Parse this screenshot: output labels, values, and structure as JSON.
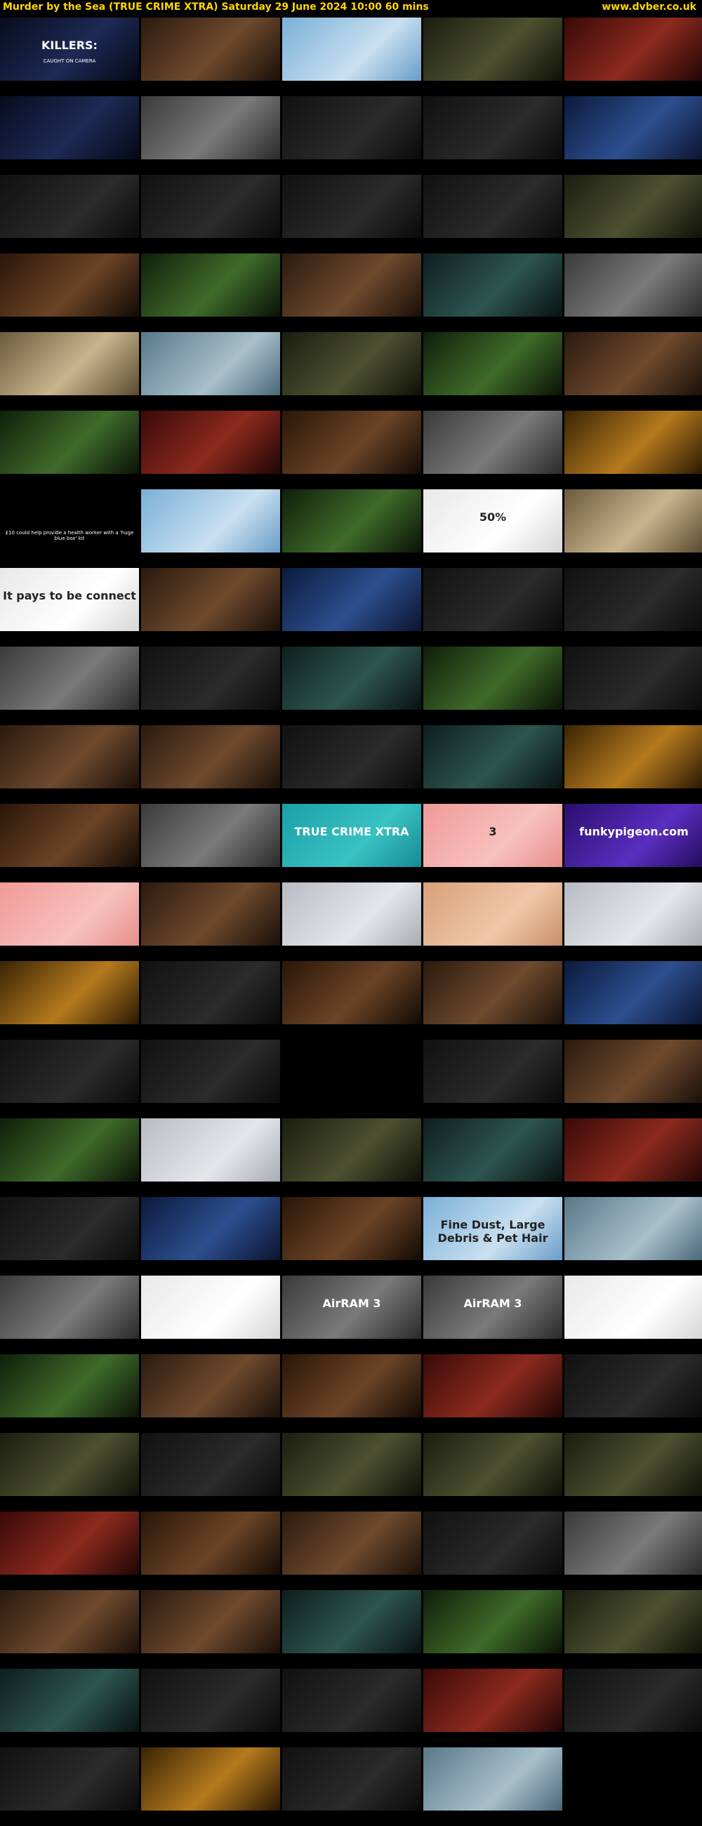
{
  "header": {
    "title": "Murder by the Sea (TRUE CRIME XTRA)    Saturday 29 June 2024  10:00  60 mins",
    "site": "www.dvber.co.uk"
  },
  "thumbnails": [
    [
      {
        "c": "navy",
        "big": "KILLERS:",
        "sm": "CAUGHT ON CAMERA"
      },
      {
        "c": "brown"
      },
      {
        "c": "sky"
      },
      {
        "c": "olive"
      },
      {
        "c": "red"
      }
    ],
    [
      {
        "c": "navy"
      },
      {
        "c": "grey"
      },
      {
        "c": "dark"
      },
      {
        "c": "dark"
      },
      {
        "c": "blue"
      }
    ],
    [
      {
        "c": "dark"
      },
      {
        "c": "dark"
      },
      {
        "c": "dark"
      },
      {
        "c": "dark"
      },
      {
        "c": "olive"
      }
    ],
    [
      {
        "c": "warm"
      },
      {
        "c": "green"
      },
      {
        "c": "brown"
      },
      {
        "c": "teal"
      },
      {
        "c": "grey"
      }
    ],
    [
      {
        "c": "sand"
      },
      {
        "c": "sea"
      },
      {
        "c": "olive"
      },
      {
        "c": "green"
      },
      {
        "c": "brown"
      }
    ],
    [
      {
        "c": "green"
      },
      {
        "c": "red"
      },
      {
        "c": "warm"
      },
      {
        "c": "grey"
      },
      {
        "c": "amber"
      }
    ],
    [
      {
        "c": "black",
        "sm": "£10 could help provide a health worker with a 'huge blue box' kit"
      },
      {
        "c": "sky"
      },
      {
        "c": "green"
      },
      {
        "c": "white",
        "big": "50%"
      },
      {
        "c": "sand"
      }
    ],
    [
      {
        "c": "white",
        "big": "It pays to be connect"
      },
      {
        "c": "brown"
      },
      {
        "c": "blue"
      },
      {
        "c": "dark"
      },
      {
        "c": "dark"
      }
    ],
    [
      {
        "c": "grey"
      },
      {
        "c": "dark"
      },
      {
        "c": "teal"
      },
      {
        "c": "green"
      },
      {
        "c": "dark"
      }
    ],
    [
      {
        "c": "brown"
      },
      {
        "c": "brown"
      },
      {
        "c": "dark"
      },
      {
        "c": "teal"
      },
      {
        "c": "amber"
      }
    ],
    [
      {
        "c": "warm"
      },
      {
        "c": "grey"
      },
      {
        "c": "cyan",
        "big": "TRUE CRIME XTRA"
      },
      {
        "c": "pink",
        "big": "3"
      },
      {
        "c": "purple",
        "big": "funkypigeon.com"
      }
    ],
    [
      {
        "c": "pink"
      },
      {
        "c": "brown"
      },
      {
        "c": "light"
      },
      {
        "c": "peach"
      },
      {
        "c": "light"
      }
    ],
    [
      {
        "c": "amber"
      },
      {
        "c": "dark"
      },
      {
        "c": "warm"
      },
      {
        "c": "brown"
      },
      {
        "c": "blue"
      }
    ],
    [
      {
        "c": "dark"
      },
      {
        "c": "dark"
      },
      {
        "c": "black"
      },
      {
        "c": "dark"
      },
      {
        "c": "brown"
      }
    ],
    [
      {
        "c": "green"
      },
      {
        "c": "light"
      },
      {
        "c": "olive"
      },
      {
        "c": "teal"
      },
      {
        "c": "red"
      }
    ],
    [
      {
        "c": "dark"
      },
      {
        "c": "blue"
      },
      {
        "c": "warm"
      },
      {
        "c": "sky",
        "big": "Fine Dust, Large Debris & Pet Hair"
      },
      {
        "c": "sea"
      }
    ],
    [
      {
        "c": "grey"
      },
      {
        "c": "white"
      },
      {
        "c": "grey",
        "big": "AirRAM 3"
      },
      {
        "c": "grey",
        "big": "AirRAM 3"
      },
      {
        "c": "white"
      }
    ],
    [
      {
        "c": "green"
      },
      {
        "c": "brown"
      },
      {
        "c": "warm"
      },
      {
        "c": "red"
      },
      {
        "c": "dark"
      }
    ],
    [
      {
        "c": "olive"
      },
      {
        "c": "dark"
      },
      {
        "c": "olive"
      },
      {
        "c": "olive"
      },
      {
        "c": "olive"
      }
    ],
    [
      {
        "c": "red"
      },
      {
        "c": "warm"
      },
      {
        "c": "brown"
      },
      {
        "c": "dark"
      },
      {
        "c": "grey"
      }
    ],
    [
      {
        "c": "brown"
      },
      {
        "c": "brown"
      },
      {
        "c": "teal"
      },
      {
        "c": "green"
      },
      {
        "c": "olive"
      }
    ],
    [
      {
        "c": "teal"
      },
      {
        "c": "dark"
      },
      {
        "c": "dark"
      },
      {
        "c": "red"
      },
      {
        "c": "dark"
      }
    ],
    [
      {
        "c": "dark"
      },
      {
        "c": "amber"
      },
      {
        "c": "dark"
      },
      {
        "c": "sea"
      }
    ]
  ]
}
